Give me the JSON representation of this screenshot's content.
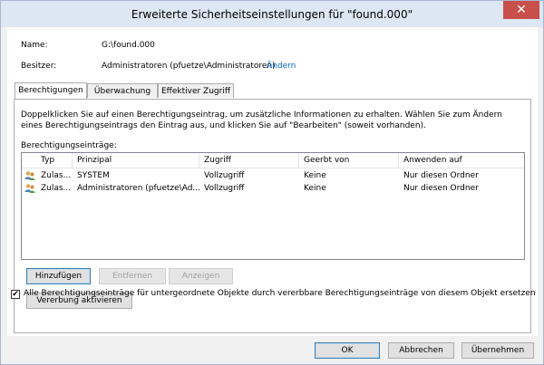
{
  "window": {
    "title": "Erweiterte Sicherheitseinstellungen für \"found.000\"",
    "close_glyph": "✕"
  },
  "fields": {
    "name_label": "Name:",
    "name_value": "G:\\found.000",
    "owner_label": "Besitzer:",
    "owner_value": "Administratoren (pfuetze\\Administratoren)",
    "owner_change_link": "Ändern"
  },
  "tabs": [
    {
      "label": "Berechtigungen",
      "active": true
    },
    {
      "label": "Überwachung",
      "active": false
    },
    {
      "label": "Effektiver Zugriff",
      "active": false
    }
  ],
  "panel": {
    "description": "Doppelklicken Sie auf einen Berechtigungseintrag, um zusätzliche Informationen zu erhalten. Wählen Sie zum Ändern eines Berechtigungseintrags den Eintrag aus, und klicken Sie auf \"Bearbeiten\" (soweit vorhanden).",
    "entries_label": "Berechtigungseinträge:"
  },
  "table": {
    "columns": [
      "Typ",
      "Prinzipal",
      "Zugriff",
      "Geerbt von",
      "Anwenden auf"
    ],
    "rows": [
      {
        "icon": "users-icon",
        "typ": "Zulas...",
        "prinzipal": "SYSTEM",
        "zugriff": "Vollzugriff",
        "geerbt": "Keine",
        "anwenden": "Nur diesen Ordner"
      },
      {
        "icon": "users-icon",
        "typ": "Zulas...",
        "prinzipal": "Administratoren (pfuetze\\Ad...",
        "zugriff": "Vollzugriff",
        "geerbt": "Keine",
        "anwenden": "Nur diesen Ordner"
      }
    ]
  },
  "buttons": {
    "add": "Hinzufügen",
    "remove": "Entfernen",
    "view": "Anzeigen",
    "enable_inheritance": "Vererbung aktivieren",
    "ok": "OK",
    "cancel": "Abbrechen",
    "apply": "Übernehmen"
  },
  "checkbox": {
    "checked": true,
    "mark": "✔",
    "label": "Alle Berechtigungseinträge für untergeordnete Objekte durch vererbbare Berechtigungseinträge von diesem Objekt ersetzen"
  }
}
